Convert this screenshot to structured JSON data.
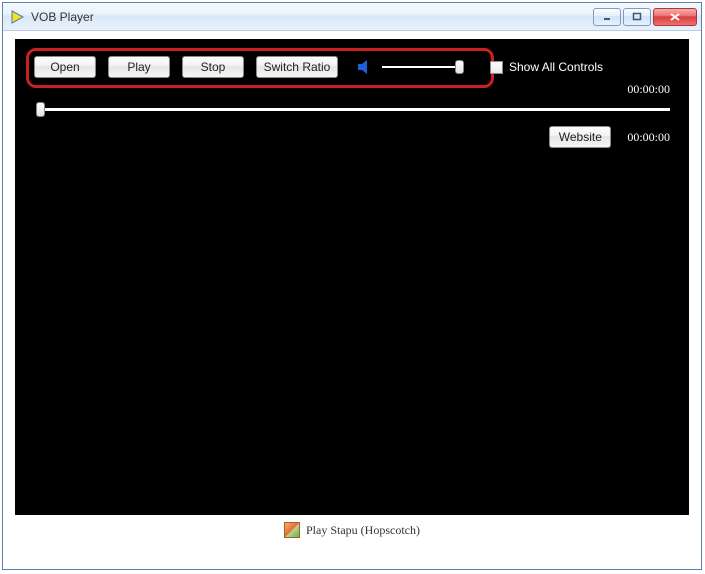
{
  "window": {
    "title": "VOB Player"
  },
  "toolbar": {
    "open": "Open",
    "play": "Play",
    "stop": "Stop",
    "switch_ratio": "Switch Ratio",
    "show_all_controls": "Show All Controls"
  },
  "times": {
    "elapsed": "00:00:00",
    "total": "00:00:00"
  },
  "secondary": {
    "website": "Website"
  },
  "footer": {
    "text": "Play Stapu (Hopscotch)"
  }
}
